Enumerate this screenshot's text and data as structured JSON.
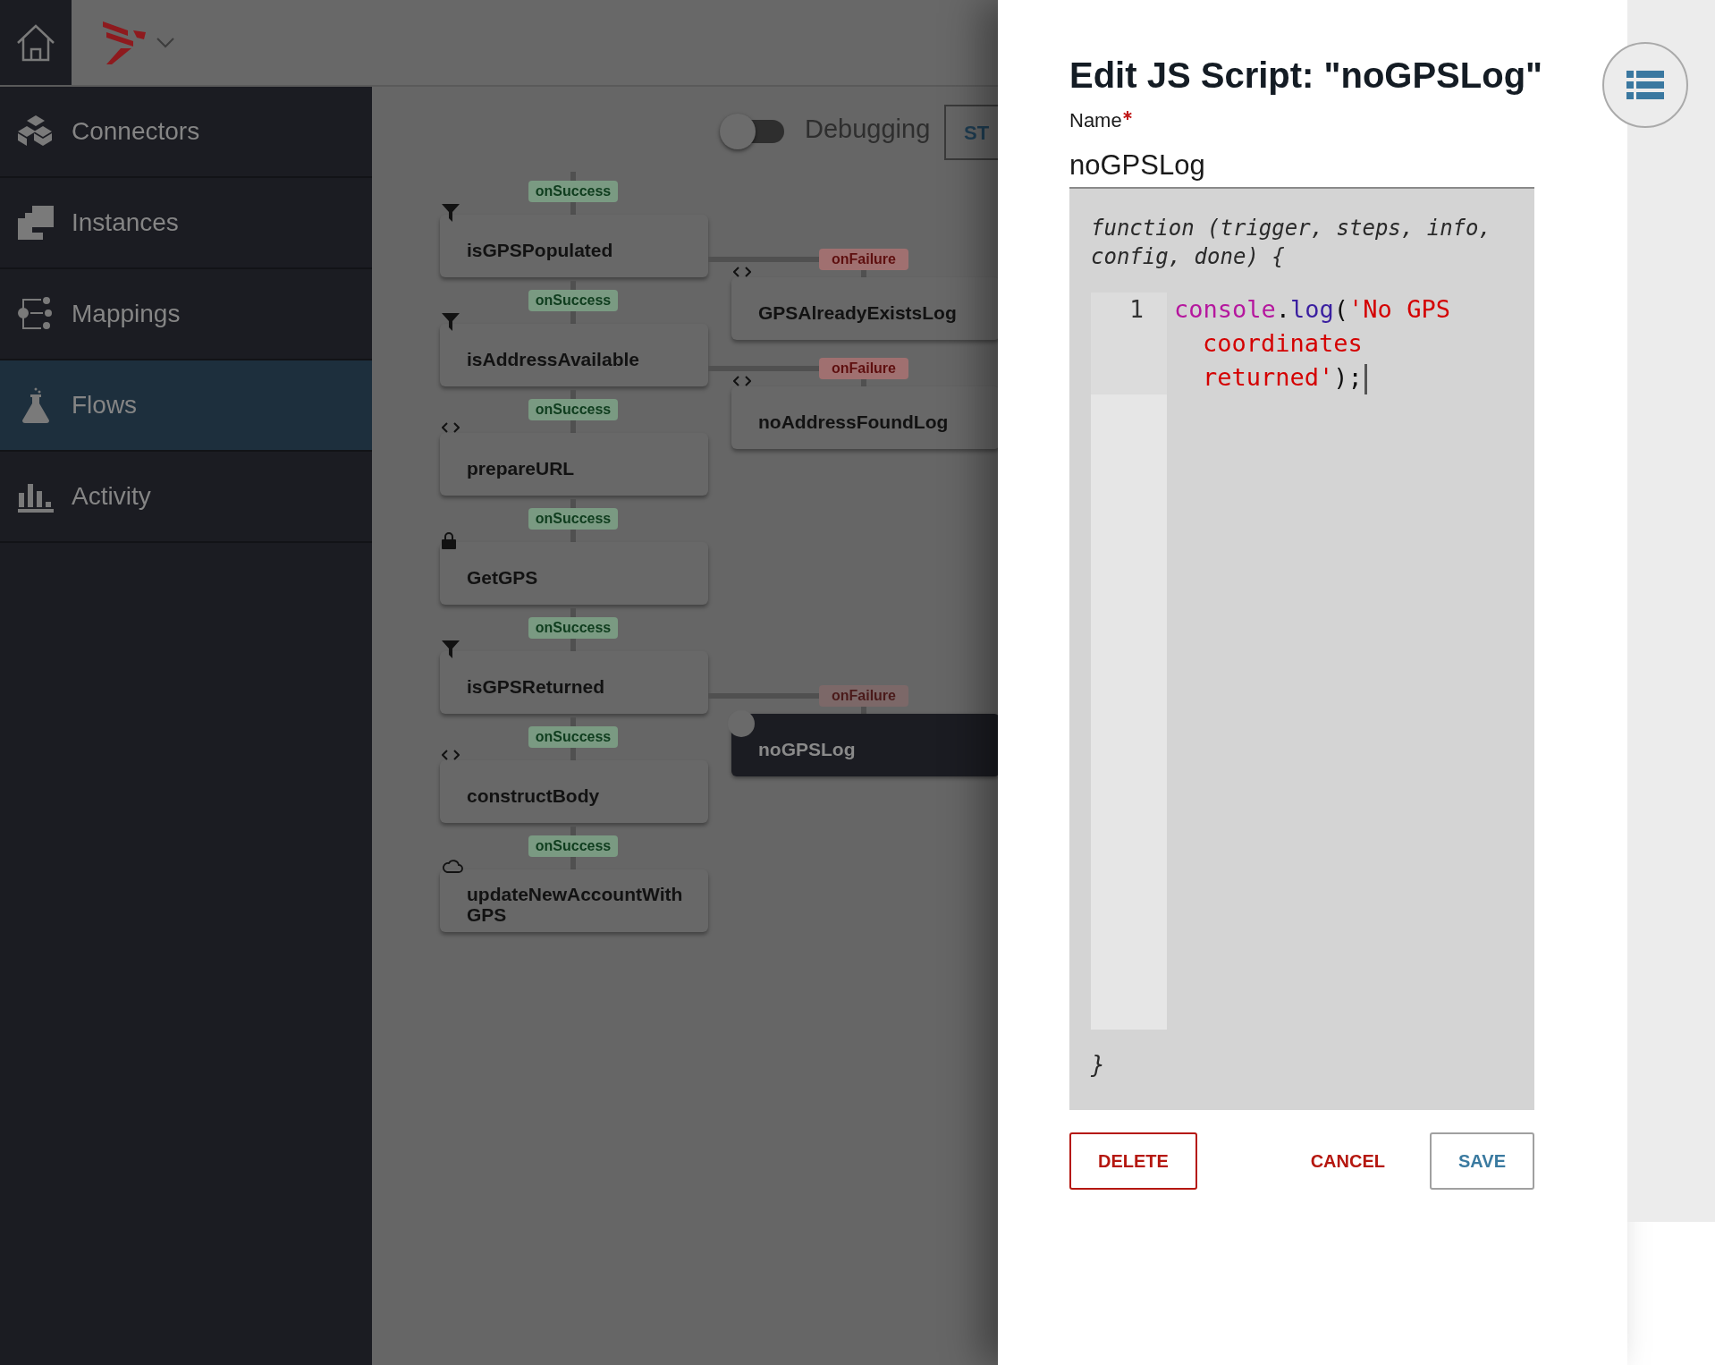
{
  "sidebar": {
    "items": [
      {
        "label": "Connectors",
        "selected": false
      },
      {
        "label": "Instances",
        "selected": false
      },
      {
        "label": "Mappings",
        "selected": false
      },
      {
        "label": "Flows",
        "selected": true
      },
      {
        "label": "Activity",
        "selected": false
      }
    ]
  },
  "toolbar": {
    "debugging": {
      "label": "Debugging",
      "on": false
    },
    "button": {
      "label": "ST"
    }
  },
  "flow": {
    "steps": [
      {
        "edge_label": "onSuccess",
        "name": "isGPSPopulated",
        "kind": "filter",
        "selected": false,
        "failure": {
          "edge_label": "onFailure",
          "name": "GPSAlreadyExistsLog",
          "kind": "script",
          "selected": false
        }
      },
      {
        "edge_label": "onSuccess",
        "name": "isAddressAvailable",
        "kind": "filter",
        "selected": false,
        "failure": {
          "edge_label": "onFailure",
          "name": "noAddressFoundLog",
          "kind": "script",
          "selected": false
        }
      },
      {
        "edge_label": "onSuccess",
        "name": "prepareURL",
        "kind": "script",
        "selected": false
      },
      {
        "edge_label": "onSuccess",
        "name": "GetGPS",
        "kind": "lock",
        "selected": false
      },
      {
        "edge_label": "onSuccess",
        "name": "isGPSReturned",
        "kind": "filter",
        "selected": false,
        "failure": {
          "edge_label": "onFailure",
          "name": "noGPSLog",
          "selected": true
        }
      },
      {
        "edge_label": "onSuccess",
        "name": "constructBody",
        "kind": "script",
        "selected": false
      },
      {
        "edge_label": "onSuccess",
        "name": "updateNewAccountWithGPS",
        "kind": "cloud",
        "selected": false
      }
    ]
  },
  "panel": {
    "title": "Edit JS Script: \"noGPSLog\"",
    "name_field": {
      "label": "Name",
      "required": true,
      "value": "noGPSLog"
    },
    "editor": {
      "header": "function (trigger, steps, info, config, done) {",
      "footer": "}",
      "lines": [
        {
          "number": "1",
          "tokens": [
            {
              "text": "console",
              "kind": "variable"
            },
            {
              "text": ".",
              "kind": "punct"
            },
            {
              "text": "log",
              "kind": "property"
            },
            {
              "text": "(",
              "kind": "punct"
            },
            {
              "text": "'No GPS coordinates returned'",
              "kind": "string"
            },
            {
              "text": ");",
              "kind": "punct"
            }
          ]
        }
      ]
    },
    "buttons": [
      {
        "label": "DELETE",
        "kind": "danger-outline"
      },
      {
        "label": "CANCEL",
        "kind": "danger-text"
      },
      {
        "label": "SAVE",
        "kind": "outline"
      }
    ]
  }
}
